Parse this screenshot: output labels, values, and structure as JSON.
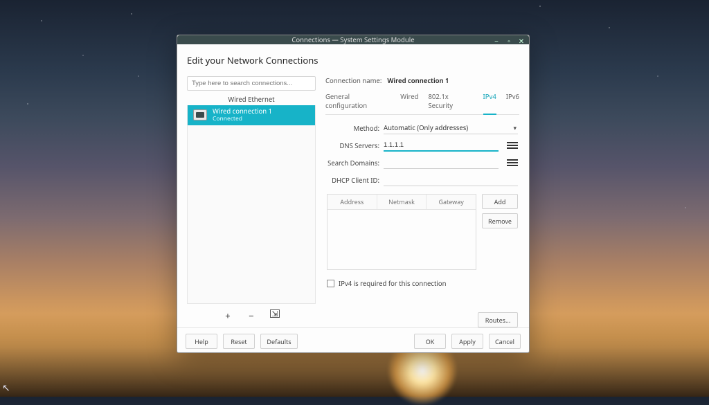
{
  "window": {
    "title": "Connections — System Settings Module"
  },
  "heading": "Edit your Network Connections",
  "search": {
    "placeholder": "Type here to search connections..."
  },
  "sidebar": {
    "section": "Wired Ethernet",
    "items": [
      {
        "name": "Wired connection 1",
        "status": "Connected"
      }
    ],
    "toolbar": {
      "add": "+",
      "remove": "−"
    }
  },
  "main": {
    "conn_label": "Connection name:",
    "conn_value": "Wired connection 1",
    "tabs": [
      {
        "label": "General configuration"
      },
      {
        "label": "Wired"
      },
      {
        "label": "802.1x Security"
      },
      {
        "label": "IPv4",
        "active": true
      },
      {
        "label": "IPv6"
      }
    ],
    "fields": {
      "method_label": "Method:",
      "method_value": "Automatic (Only addresses)",
      "dns_label": "DNS Servers:",
      "dns_value": "1.1.1.1",
      "search_label": "Search Domains:",
      "search_value": "",
      "dhcp_label": "DHCP Client ID:",
      "dhcp_value": ""
    },
    "table": {
      "cols": [
        "Address",
        "Netmask",
        "Gateway"
      ],
      "add": "Add",
      "remove": "Remove"
    },
    "ipv4_required": "IPv4 is required for this connection",
    "routes": "Routes..."
  },
  "footer": {
    "help": "Help",
    "reset": "Reset",
    "defaults": "Defaults",
    "ok": "OK",
    "apply": "Apply",
    "cancel": "Cancel"
  }
}
